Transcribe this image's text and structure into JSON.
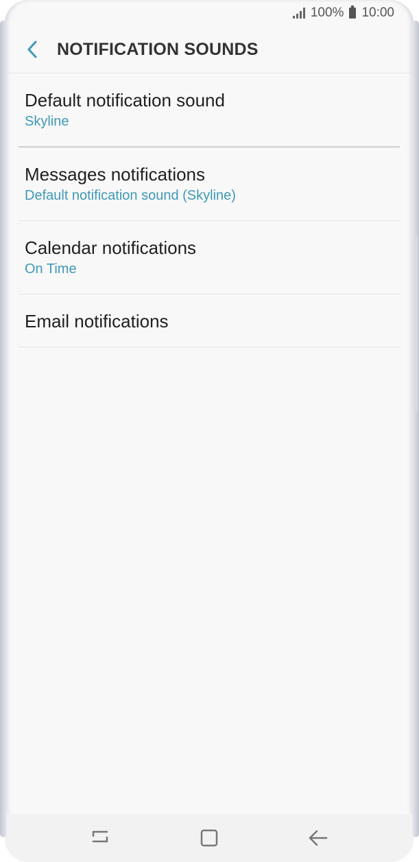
{
  "status_bar": {
    "battery": "100%",
    "time": "10:00",
    "icons": [
      "signal-icon",
      "battery-icon"
    ]
  },
  "header": {
    "title": "NOTIFICATION SOUNDS",
    "back_icon": "back-arrow-icon"
  },
  "items": [
    {
      "title": "Default notification sound",
      "subtitle": "Skyline"
    },
    {
      "title": "Messages notifications",
      "subtitle": "Default notification sound (Skyline)"
    },
    {
      "title": "Calendar notifications",
      "subtitle": "On Time"
    },
    {
      "title": "Email notifications"
    }
  ],
  "nav": {
    "icons": [
      "recent-apps-icon",
      "home-icon",
      "back-icon"
    ]
  },
  "colors": {
    "accent": "#3e98b8",
    "background": "#f8f8f8"
  }
}
